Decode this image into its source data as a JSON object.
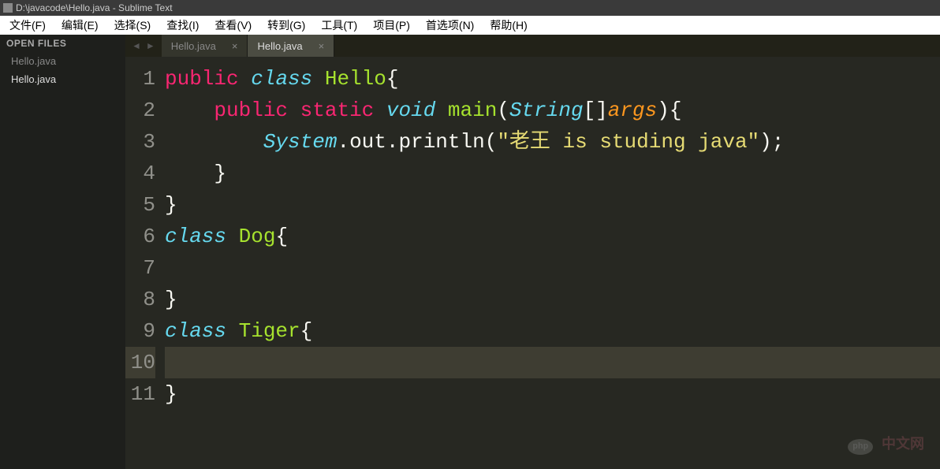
{
  "window": {
    "title": "D:\\javacode\\Hello.java - Sublime Text"
  },
  "menu": {
    "items": [
      "文件(F)",
      "编辑(E)",
      "选择(S)",
      "查找(I)",
      "查看(V)",
      "转到(G)",
      "工具(T)",
      "项目(P)",
      "首选项(N)",
      "帮助(H)"
    ]
  },
  "sidebar": {
    "header": "OPEN FILES",
    "items": [
      {
        "label": "Hello.java",
        "active": false
      },
      {
        "label": "Hello.java",
        "active": true
      }
    ]
  },
  "tabs": {
    "items": [
      {
        "label": "Hello.java",
        "active": false
      },
      {
        "label": "Hello.java",
        "active": true
      }
    ]
  },
  "editor": {
    "current_line": 10,
    "lines": [
      {
        "n": 1,
        "tokens": [
          [
            "kw-mod",
            "public"
          ],
          [
            "punct",
            " "
          ],
          [
            "kw-decl",
            "class"
          ],
          [
            "punct",
            " "
          ],
          [
            "classname",
            "Hello"
          ],
          [
            "punct",
            "{"
          ]
        ]
      },
      {
        "n": 2,
        "tokens": [
          [
            "punct",
            "\t"
          ],
          [
            "kw-mod",
            "public"
          ],
          [
            "punct",
            " "
          ],
          [
            "kw-mod",
            "static"
          ],
          [
            "punct",
            " "
          ],
          [
            "type",
            "void"
          ],
          [
            "punct",
            " "
          ],
          [
            "funcname",
            "main"
          ],
          [
            "punct",
            "("
          ],
          [
            "type",
            "String"
          ],
          [
            "punct",
            "[]"
          ],
          [
            "param",
            "args"
          ],
          [
            "punct",
            "){"
          ]
        ]
      },
      {
        "n": 3,
        "tokens": [
          [
            "punct",
            "\t\t"
          ],
          [
            "type",
            "System"
          ],
          [
            "punct",
            "."
          ],
          [
            "ident",
            "out"
          ],
          [
            "punct",
            "."
          ],
          [
            "ident",
            "println"
          ],
          [
            "punct",
            "("
          ],
          [
            "string",
            "\"老王 is studing java\""
          ],
          [
            "punct",
            ");"
          ]
        ]
      },
      {
        "n": 4,
        "tokens": [
          [
            "punct",
            "\t}"
          ]
        ]
      },
      {
        "n": 5,
        "tokens": [
          [
            "punct",
            "}"
          ]
        ]
      },
      {
        "n": 6,
        "tokens": [
          [
            "kw-decl",
            "class"
          ],
          [
            "punct",
            " "
          ],
          [
            "classname",
            "Dog"
          ],
          [
            "punct",
            "{"
          ]
        ]
      },
      {
        "n": 7,
        "tokens": []
      },
      {
        "n": 8,
        "tokens": [
          [
            "punct",
            "}"
          ]
        ]
      },
      {
        "n": 9,
        "tokens": [
          [
            "kw-decl",
            "class"
          ],
          [
            "punct",
            " "
          ],
          [
            "classname",
            "Tiger"
          ],
          [
            "punct",
            "{"
          ]
        ]
      },
      {
        "n": 10,
        "tokens": []
      },
      {
        "n": 11,
        "tokens": [
          [
            "punct",
            "}"
          ]
        ]
      }
    ]
  },
  "watermark": {
    "badge": "php",
    "text": "中文网"
  }
}
